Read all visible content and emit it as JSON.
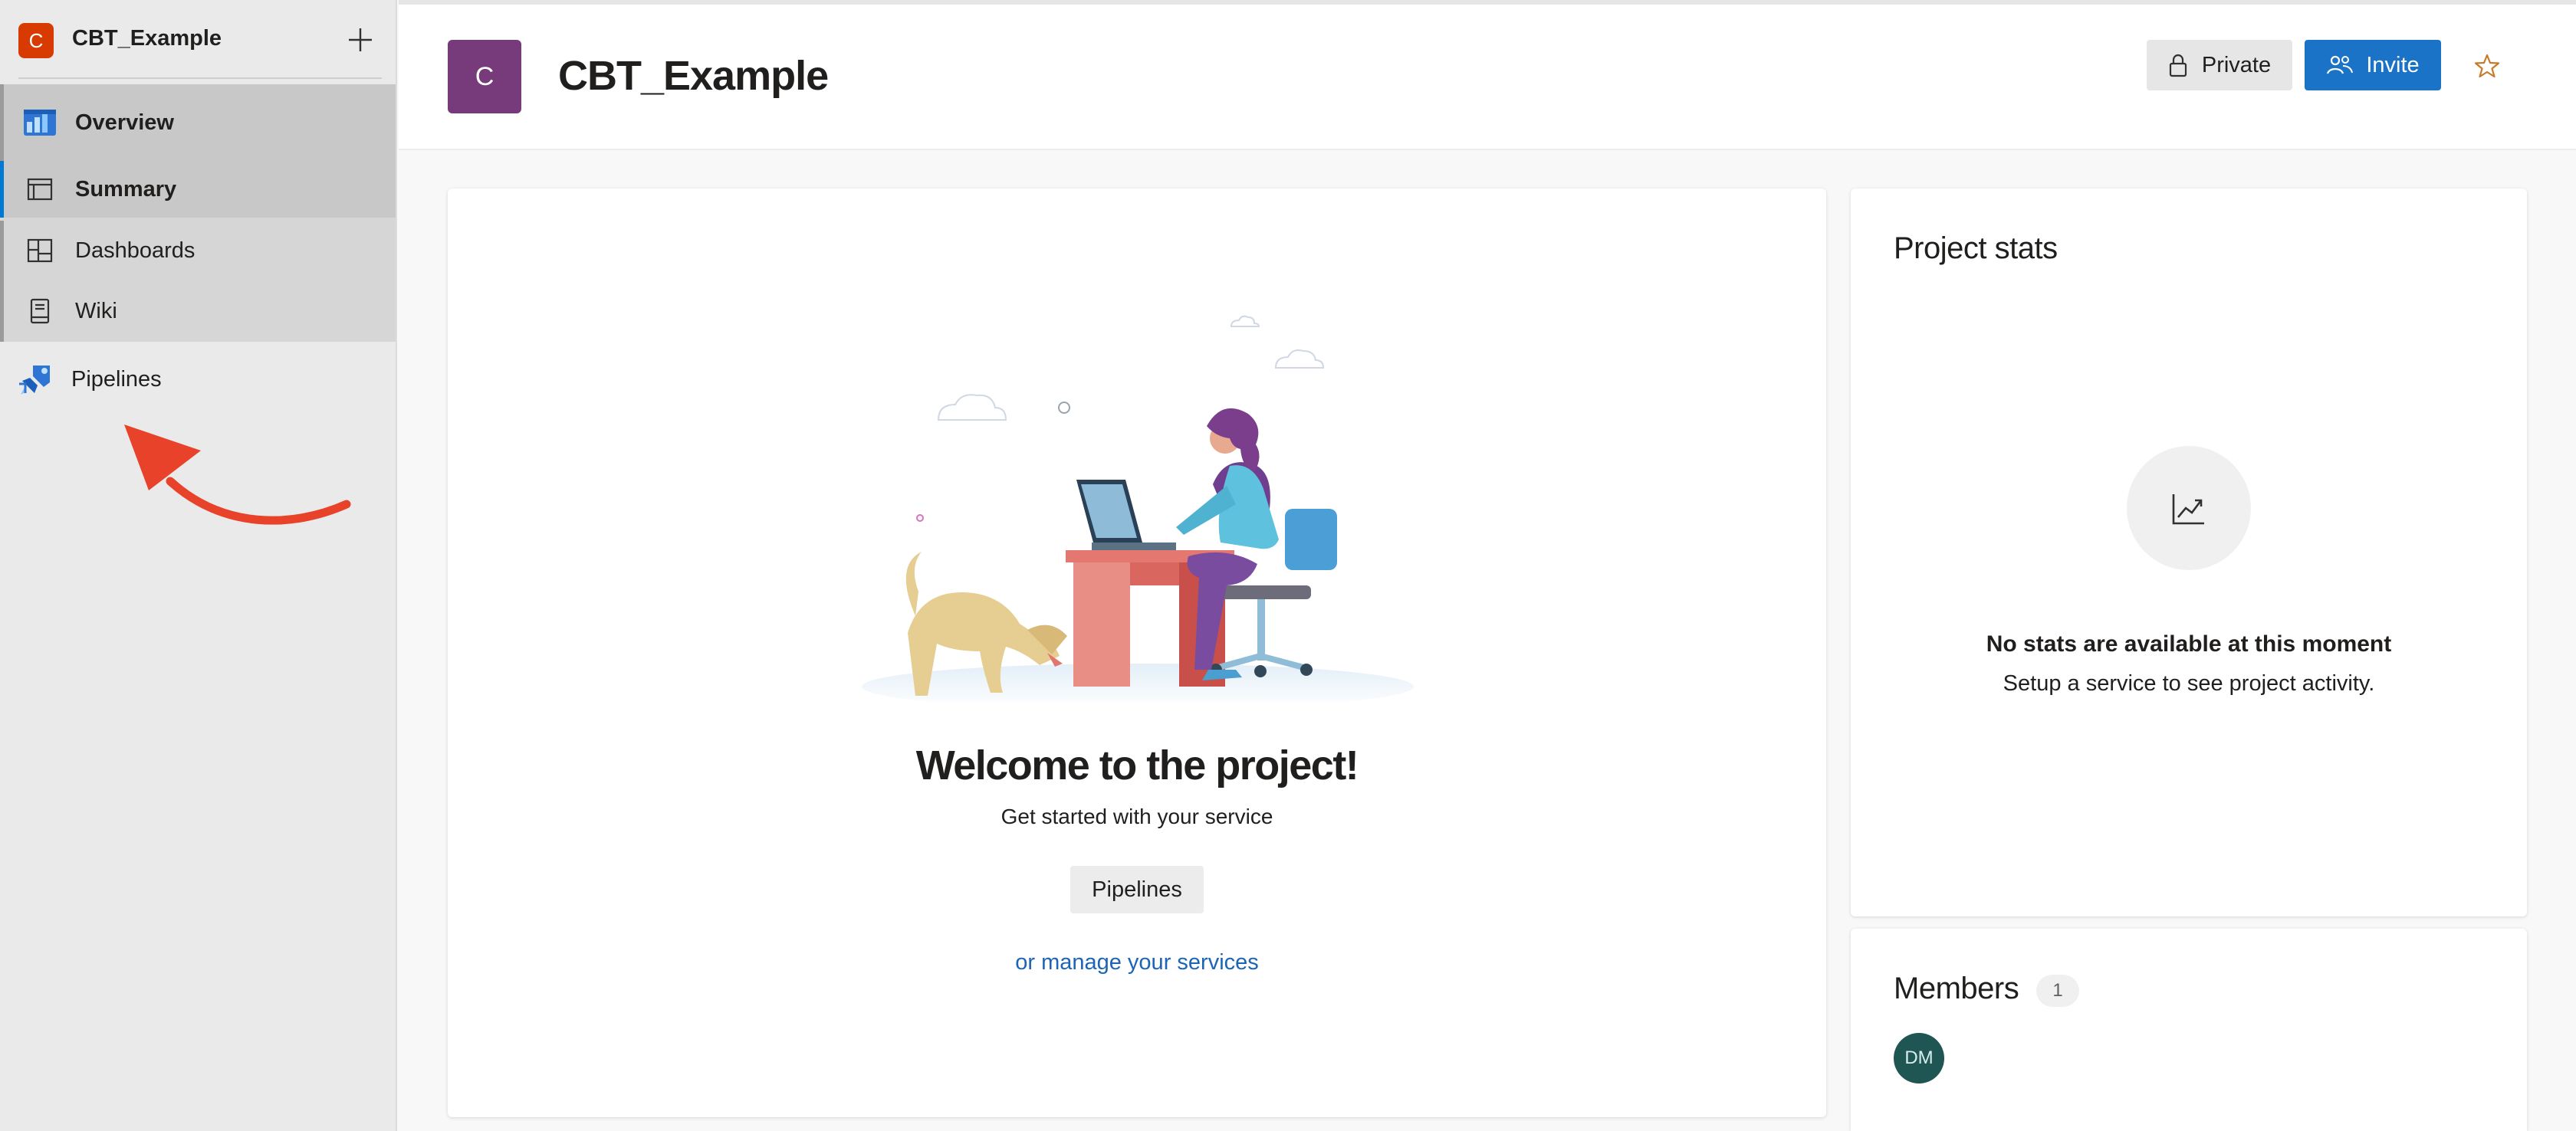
{
  "sidebar": {
    "project_initial": "C",
    "project_name": "CBT_Example",
    "items": [
      {
        "label": "Overview"
      },
      {
        "label": "Summary"
      },
      {
        "label": "Dashboards"
      },
      {
        "label": "Wiki"
      },
      {
        "label": "Pipelines"
      }
    ]
  },
  "header": {
    "avatar_initial": "C",
    "title": "CBT_Example",
    "private_label": "Private",
    "invite_label": "Invite"
  },
  "welcome": {
    "title": "Welcome to the project!",
    "subtitle": "Get started with your service",
    "button_label": "Pipelines",
    "link_label": "or manage your services"
  },
  "stats": {
    "title": "Project stats",
    "empty_title": "No stats are available at this moment",
    "empty_subtitle": "Setup a service to see project activity."
  },
  "members": {
    "title": "Members",
    "count": "1",
    "list": [
      {
        "initials": "DM"
      }
    ]
  },
  "colors": {
    "project_avatar": "#d83b01",
    "header_avatar": "#773b7c",
    "invite_button": "#1a73c7",
    "link": "#1c64b4",
    "arrow": "#e8432a",
    "member_avatar": "#1f5553"
  },
  "icons": {
    "overview": "overview-icon",
    "summary": "summary-icon",
    "dashboards": "dashboards-icon",
    "wiki": "wiki-icon",
    "pipelines": "pipelines-icon",
    "plus": "plus-icon",
    "lock": "lock-icon",
    "invite": "people-icon",
    "star": "star-icon",
    "stats": "trend-chart-icon"
  }
}
